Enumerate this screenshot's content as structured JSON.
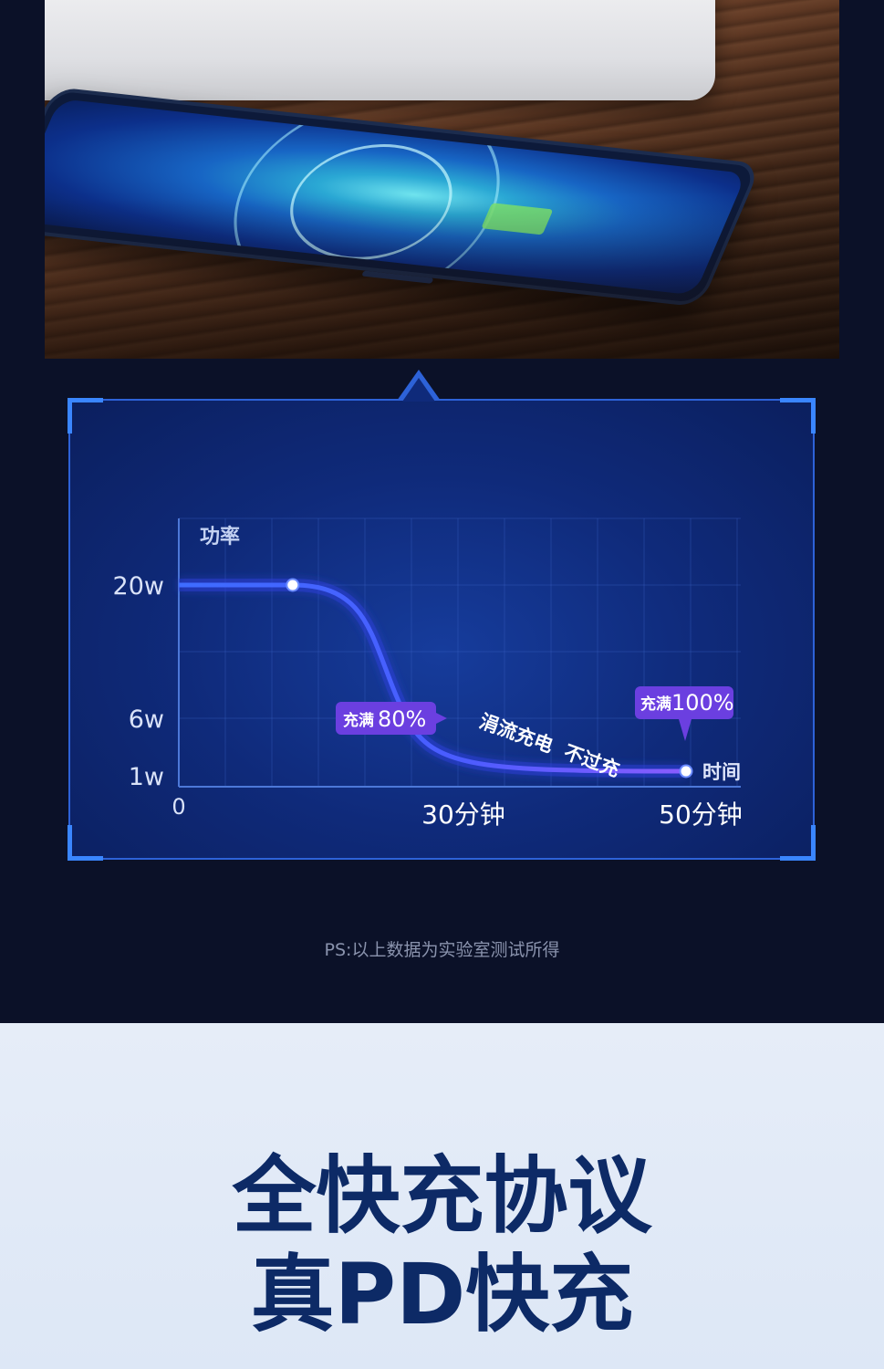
{
  "chart_data": {
    "type": "line",
    "y_axis_title": "功率",
    "x_axis_title": "时间",
    "y_tick_labels": [
      "20w",
      "6w",
      "1w"
    ],
    "x_tick_labels": [
      "0",
      "30分钟",
      "50分钟"
    ],
    "points": [
      {
        "time_min": 0,
        "power_w": 20
      },
      {
        "time_min": 12,
        "power_w": 20
      },
      {
        "time_min": 24,
        "power_w": 6
      },
      {
        "time_min": 45,
        "power_w": 1
      }
    ],
    "annotations": {
      "full80": {
        "prefix": "充满",
        "value": "80%"
      },
      "full100": {
        "prefix": "充满",
        "value": "100%"
      },
      "trickle": "涓流充电  不过充"
    },
    "colors": {
      "line": "#4a5cff",
      "glow": "#9b6bff",
      "label_bg": "#6b3fe0",
      "grid": "#3b64c8"
    }
  },
  "footnote": "PS:以上数据为实验室测试所得",
  "headline": {
    "line1": "全快充协议",
    "line2": "真PD快充"
  }
}
